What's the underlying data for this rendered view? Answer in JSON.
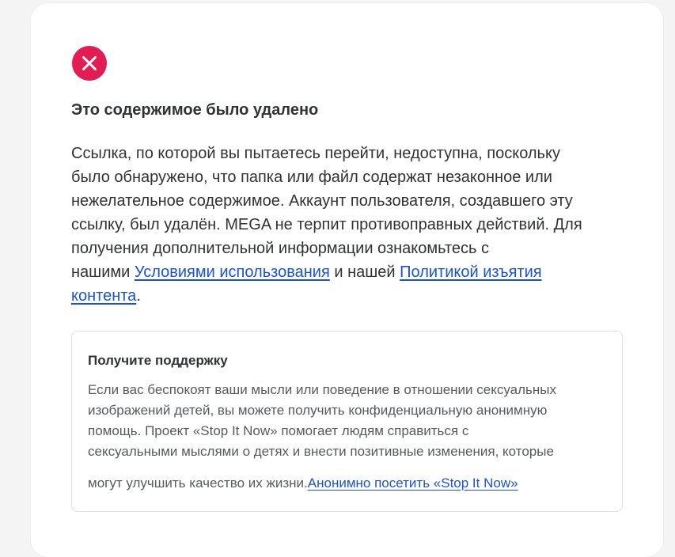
{
  "notice": {
    "icon": "error-x-icon",
    "accent_color": "#e21d55",
    "title": "Это содержимое было удалено",
    "lines": [
      "Ссылка, по которой вы пытаетесь перейти, недоступна, поскольку",
      "было обнаружено, что папка или файл содержат незаконное или",
      "нежелательное содержимое. Аккаунт пользователя, создавшего эту",
      "ссылку, был удалён. MEGA не терпит противоправных действий. Для",
      "получения дополнительной информации ознакомьтесь с"
    ],
    "prefix": "нашими ",
    "terms_link": "Условиями использования",
    "middle": " и нашей ",
    "takedown_link_part1": "Политикой изъятия",
    "takedown_link_part2": "контента",
    "suffix": "."
  },
  "support": {
    "title": "Получите поддержку",
    "lines": [
      "Если вас беспокоят ваши мысли или поведение в отношении сексуальных",
      "изображений детей, вы можете получить конфиденциальную анонимную",
      "помощь. Проект «Stop It Now» помогает людям справиться с",
      "сексуальными мыслями о детях и внести позитивные изменения, которые"
    ],
    "last_line": "могут улучшить качество их жизни.",
    "link": "Анонимно посетить «Stop It Now»"
  },
  "colors": {
    "link": "#1a52d6",
    "text": "#303233",
    "muted_text": "#575a5c"
  }
}
